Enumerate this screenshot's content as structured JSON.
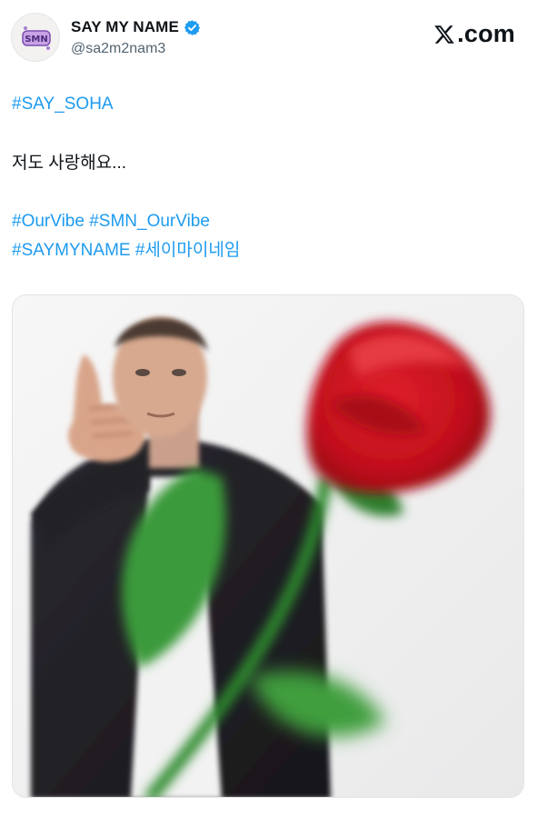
{
  "header": {
    "display_name": "SAY MY NAME",
    "handle": "@sa2m2nam3",
    "brand": ".com"
  },
  "body": {
    "hashtag_top": "#SAY_SOHA",
    "message": "저도 사랑해요...",
    "hashtags_line1": [
      "#OurVibe",
      "#SMN_OurVibe"
    ],
    "hashtags_line2": [
      "#SAYMYNAME",
      "#세이마이네임"
    ]
  },
  "icons": [
    "avatar-logo",
    "verified-badge-icon",
    "x-logo-icon"
  ],
  "colors": {
    "link": "#1d9bf0",
    "verified": "#1d9bf0",
    "text": "#0f1419",
    "secondary": "#536471",
    "rose": "#c8101e",
    "stem": "#2f8a2f"
  },
  "media": {
    "description_icon": "photo-person-with-rose"
  }
}
